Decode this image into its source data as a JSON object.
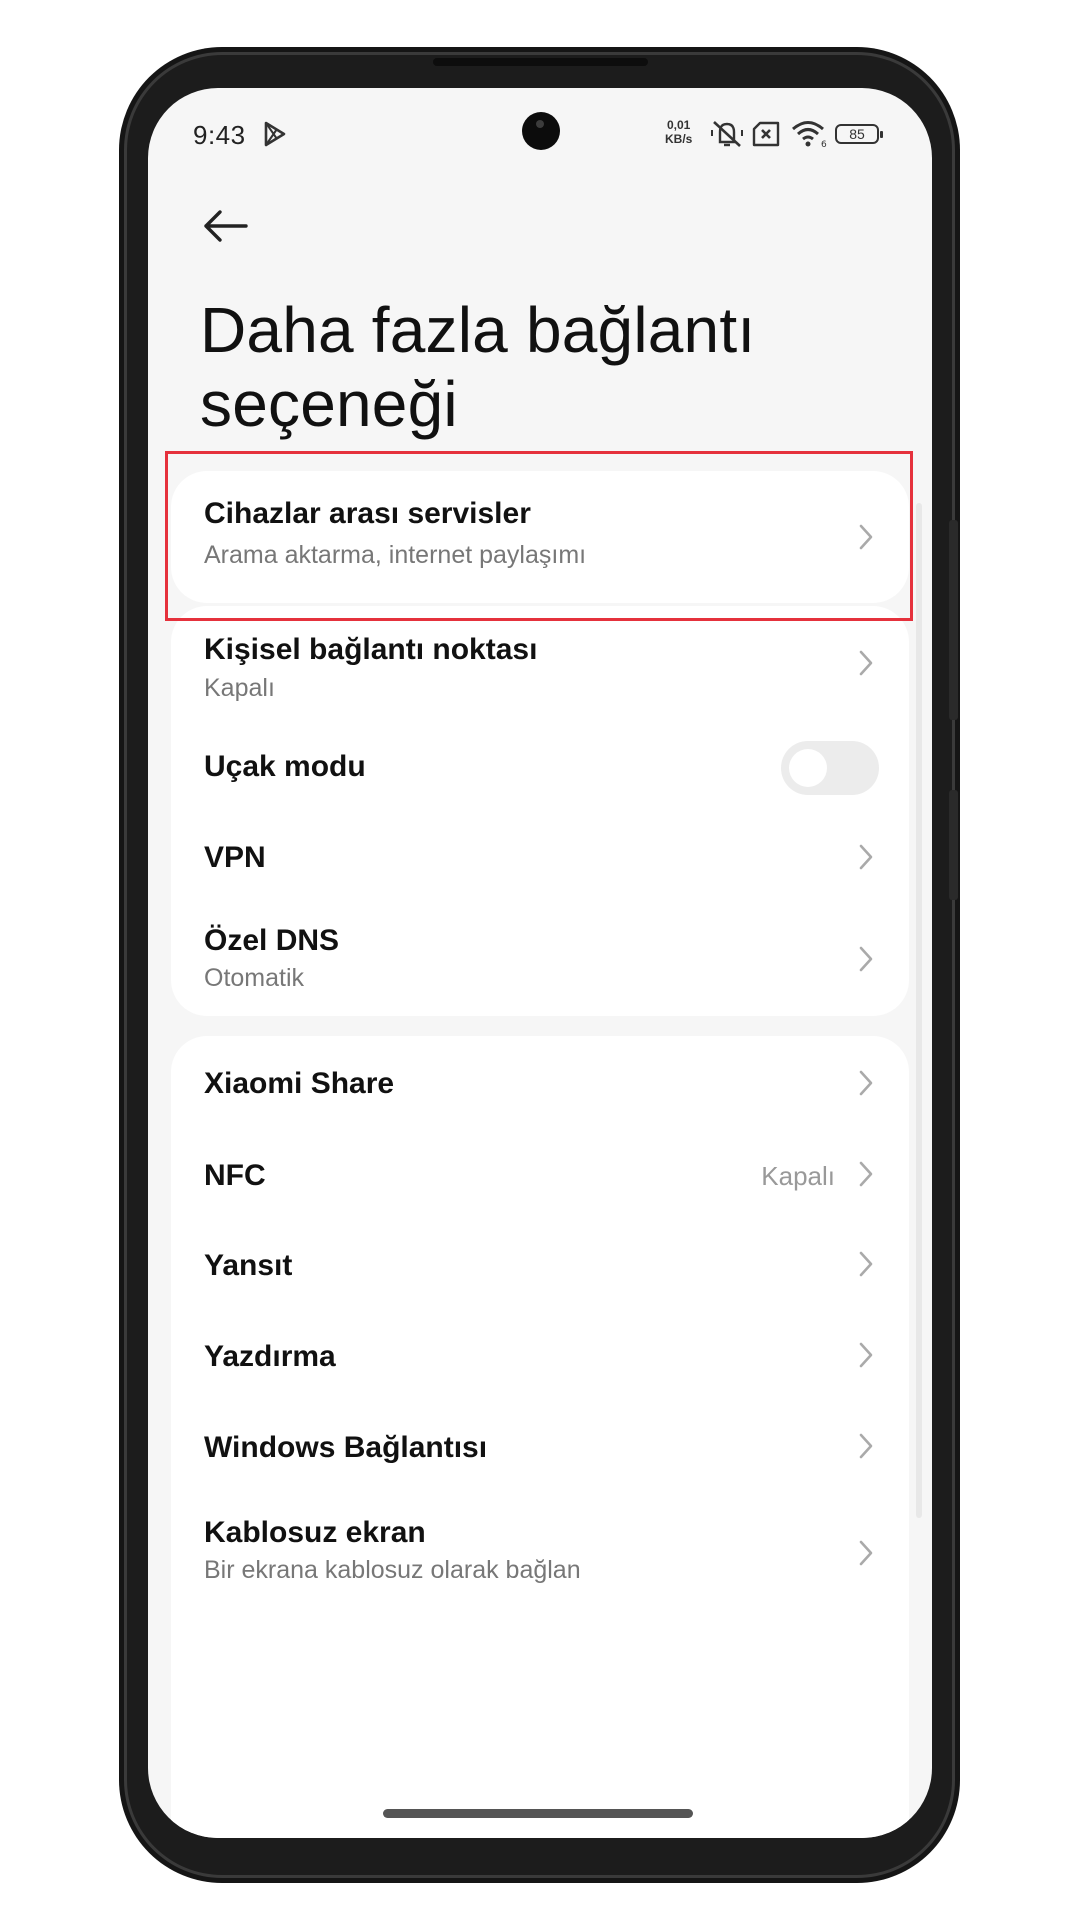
{
  "status_bar": {
    "time": "9:43",
    "net_speed_value": "0,01",
    "net_speed_unit": "KB/s",
    "battery": "85",
    "icons": [
      "play-store-icon",
      "mute-vibrate-icon",
      "sim-off-icon",
      "wifi-icon",
      "battery-icon"
    ]
  },
  "header": {
    "back_icon": "arrow-left-icon",
    "title_line1": "Daha fazla bağlantı",
    "title_line2": "seçeneği"
  },
  "highlight_color": "#e5313c",
  "groups": [
    {
      "items": [
        {
          "label": "Cihazlar arası servisler",
          "sub": "Arama aktarma, internet paylaşımı"
        }
      ]
    },
    {
      "items": [
        {
          "label": "Kişisel bağlantı noktası",
          "sub": "Kapalı"
        },
        {
          "label": "Uçak modu",
          "toggle": "off"
        },
        {
          "label": "VPN"
        },
        {
          "label": "Özel DNS",
          "sub": "Otomatik"
        }
      ]
    },
    {
      "items": [
        {
          "label": "Xiaomi Share"
        },
        {
          "label": "NFC",
          "value": "Kapalı"
        },
        {
          "label": "Yansıt"
        },
        {
          "label": "Yazdırma"
        },
        {
          "label": "Windows Bağlantısı"
        },
        {
          "label": "Kablosuz ekran",
          "sub": "Bir ekrana kablosuz olarak bağlan"
        }
      ]
    }
  ]
}
